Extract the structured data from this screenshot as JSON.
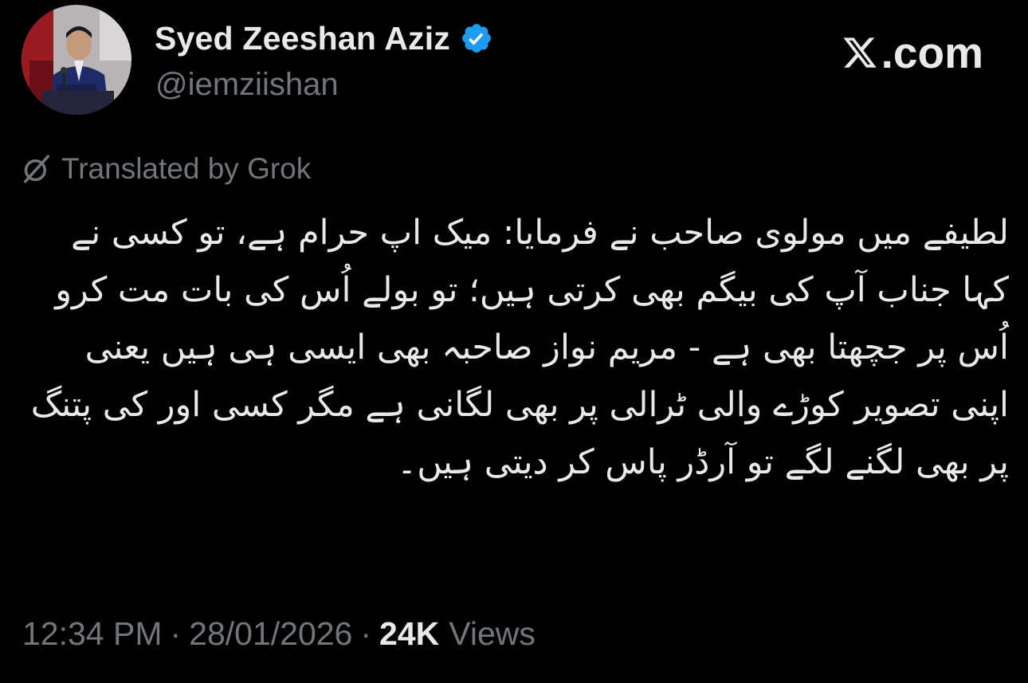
{
  "author": {
    "display_name": "Syed Zeeshan Aziz",
    "handle": "@iemziishan",
    "verified": true,
    "avatar": "profile-photo"
  },
  "brand": {
    "logo": "x-logo",
    "label": ".com"
  },
  "translation": {
    "icon": "grok-icon",
    "label": "Translated by Grok"
  },
  "tweet": {
    "text": "لطیفے میں مولوی صاحب نے فرمایا: میک اپ حرام ہے، تو کسی نے کہا جناب آپ کی بیگم بھی کرتی ہیں؛ تو بولے اُس کی بات مت کرو اُس پر جچھتا بھی ہے - مریم نواز صاحبہ بھی ایسی ہی ہیں یعنی اپنی تصویر کوڑے والی ٹرالی پر بھی لگانی ہے مگر کسی اور کی پتنگ پر بھی لگنے لگے تو آرڈر پاس کر دیتی ہیں۔"
  },
  "meta": {
    "time": "12:34 PM",
    "separator": "·",
    "date": "28/01/2026",
    "views_count": "24K",
    "views_label": "Views"
  },
  "colors": {
    "background": "#000000",
    "text_primary": "#e7e9ea",
    "text_secondary": "#71767b",
    "verified_blue": "#1d9bf0"
  }
}
